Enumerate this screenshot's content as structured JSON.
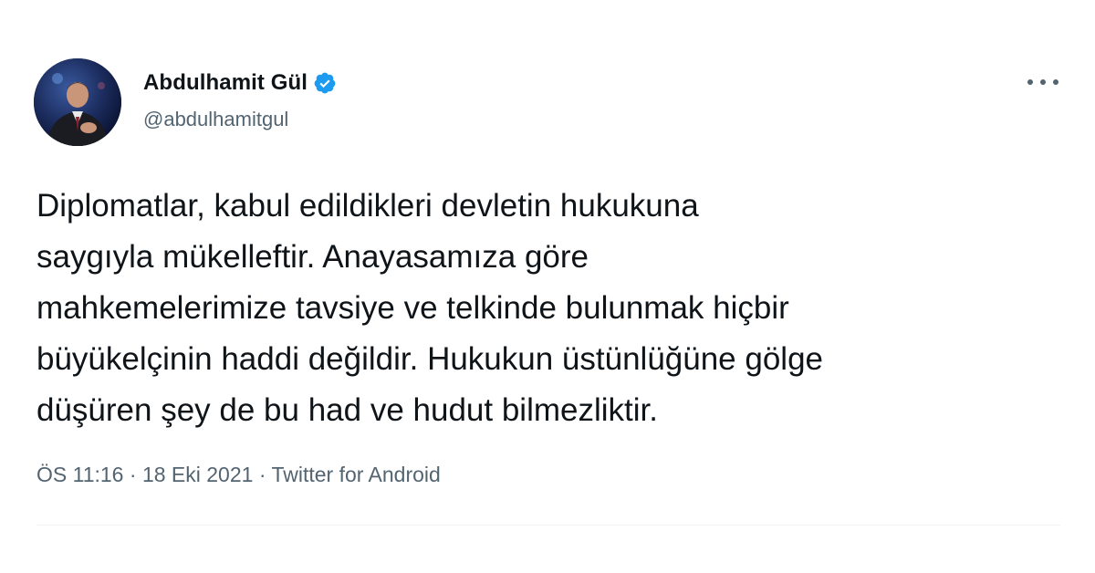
{
  "author": {
    "display_name": "Abdulhamit Gül",
    "handle": "@abdulhamitgul",
    "verified": true
  },
  "tweet": {
    "text_lines": [
      "Diplomatlar, kabul edildikleri devletin hukukuna",
      "saygıyla mükelleftir. Anayasamıza göre",
      "mahkemelerimize tavsiye ve telkinde bulunmak hiçbir",
      "büyükelçinin haddi değildir. Hukukun üstünlüğüne gölge",
      "düşüren şey de bu had ve hudut bilmezliktir."
    ],
    "time": "ÖS 11:16",
    "separator": "·",
    "date": "18 Eki 2021",
    "source": "Twitter for Android"
  },
  "icons": {
    "verified": "verified-badge-icon",
    "more": "more-options-icon"
  },
  "colors": {
    "text": "#0f1419",
    "secondary": "#536471",
    "verified": "#1d9bf0",
    "divider": "#eff3f4"
  }
}
